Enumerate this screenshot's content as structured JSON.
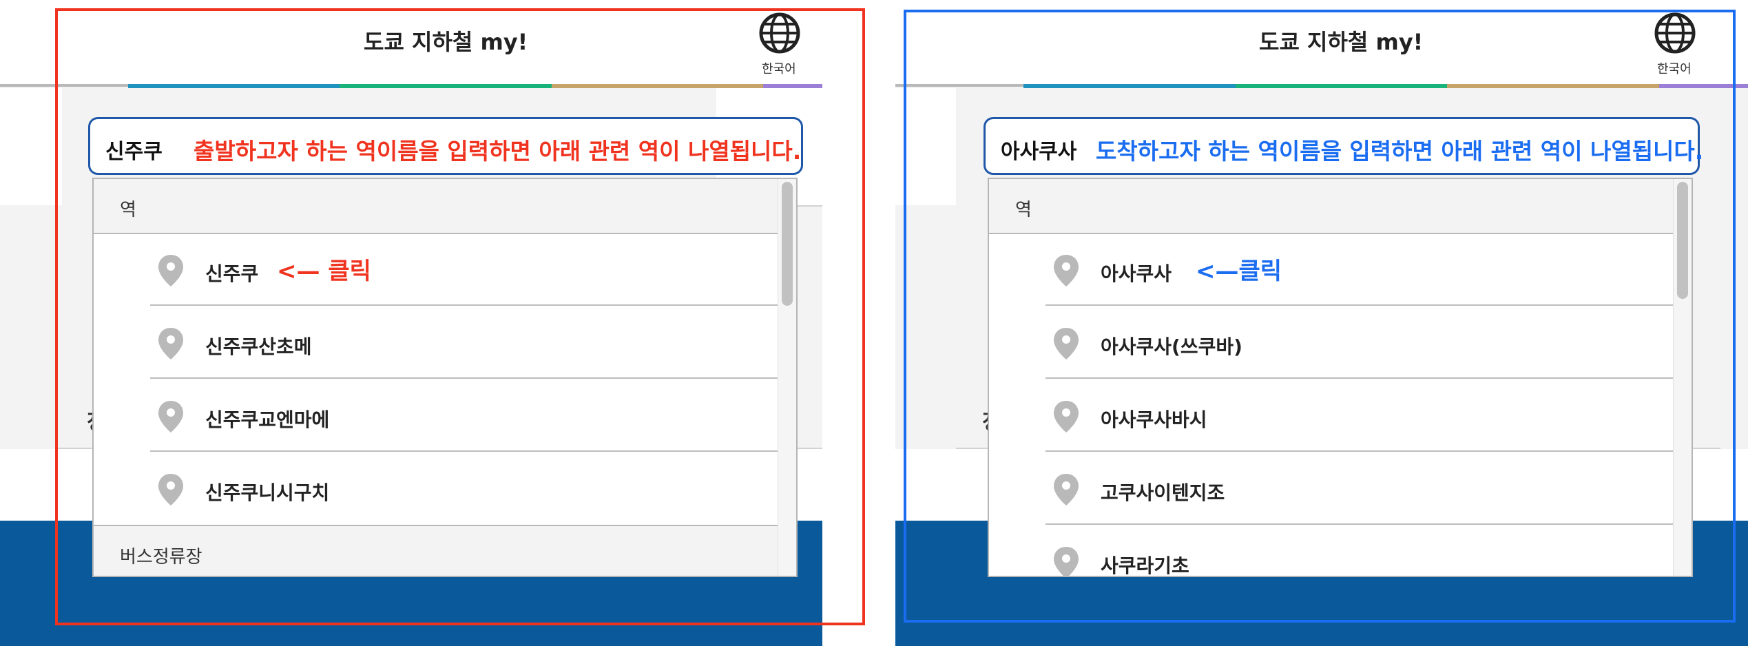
{
  "colors": {
    "red_accent": "#f0331f",
    "blue_accent": "#1a6cf0",
    "navy_footer": "#0a5a9b",
    "box_border": "#1f58a8",
    "line_bar": [
      "#1e93c0",
      "#17b37b",
      "#c5a36a",
      "#9b7fd6"
    ]
  },
  "panels": {
    "departure": {
      "app_title": "도쿄 지하철 my!",
      "language_label": "한국어",
      "search_value": "신주쿠",
      "search_hint": "출발하고자 하는 역이름을 입력하면 아래 관련 역이 나열됩니다.",
      "dropdown": {
        "section_stations_label": "역",
        "items": [
          {
            "label": "신주쿠",
            "icon": "map-pin-icon"
          },
          {
            "label": "신주쿠산초메",
            "icon": "map-pin-icon"
          },
          {
            "label": "신주쿠교엔마에",
            "icon": "map-pin-icon"
          },
          {
            "label": "신주쿠니시구치",
            "icon": "map-pin-icon"
          }
        ],
        "section_bus_label": "버스정류장",
        "click_note": "<— 클릭"
      }
    },
    "arrival": {
      "app_title": "도쿄 지하철 my!",
      "language_label": "한국어",
      "search_value": "아사쿠사",
      "search_hint": "도착하고자 하는 역이름을 입력하면 아래 관련 역이 나열됩니다.",
      "dropdown": {
        "section_stations_label": "역",
        "items": [
          {
            "label": "아사쿠사",
            "icon": "map-pin-icon"
          },
          {
            "label": "아사쿠사(쓰쿠바)",
            "icon": "map-pin-icon"
          },
          {
            "label": "아사쿠사바시",
            "icon": "map-pin-icon"
          },
          {
            "label": "고쿠사이텐지조",
            "icon": "map-pin-icon"
          },
          {
            "label": "사쿠라기초",
            "icon": "map-pin-icon"
          }
        ],
        "click_note": "<—클릭"
      }
    }
  },
  "background_fragments": {
    "left_glyph": "정",
    "right_glyph": "정"
  }
}
